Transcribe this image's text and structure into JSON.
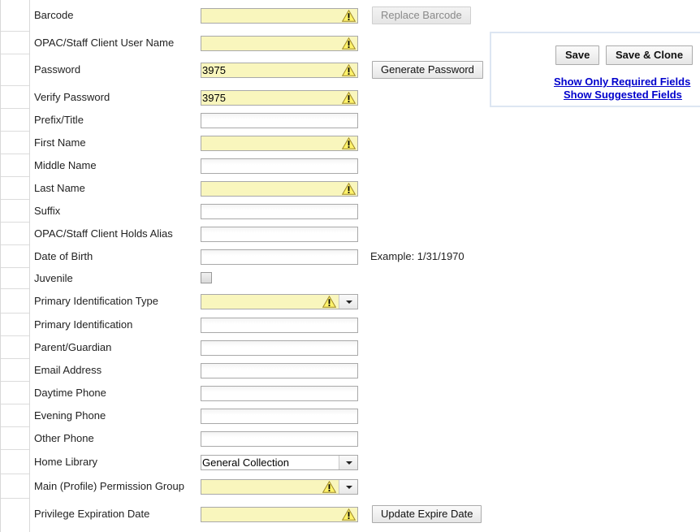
{
  "form": {
    "rows": [
      {
        "label": "Barcode",
        "value": "",
        "required": true
      },
      {
        "label": "OPAC/Staff Client User Name",
        "value": "",
        "required": true
      },
      {
        "label": "Password",
        "value": "3975",
        "required": true
      },
      {
        "label": "Verify Password",
        "value": "3975",
        "required": true
      },
      {
        "label": "Prefix/Title",
        "value": ""
      },
      {
        "label": "First Name",
        "value": "",
        "required": true
      },
      {
        "label": "Middle Name",
        "value": ""
      },
      {
        "label": "Last Name",
        "value": "",
        "required": true
      },
      {
        "label": "Suffix",
        "value": ""
      },
      {
        "label": "OPAC/Staff Client Holds Alias",
        "value": ""
      },
      {
        "label": "Date of Birth",
        "value": "",
        "hint": "Example: 1/31/1970"
      },
      {
        "label": "Juvenile",
        "checked": false
      },
      {
        "label": "Primary Identification Type",
        "value": "",
        "required": true
      },
      {
        "label": "Primary Identification",
        "value": ""
      },
      {
        "label": "Parent/Guardian",
        "value": ""
      },
      {
        "label": "Email Address",
        "value": ""
      },
      {
        "label": "Daytime Phone",
        "value": ""
      },
      {
        "label": "Evening Phone",
        "value": ""
      },
      {
        "label": "Other Phone",
        "value": ""
      },
      {
        "label": "Home Library",
        "value": "General Collection"
      },
      {
        "label": "Main (Profile) Permission Group",
        "value": "",
        "required": true
      },
      {
        "label": "Privilege Expiration Date",
        "value": "",
        "required": true
      }
    ],
    "buttons": {
      "replace_barcode": "Replace Barcode",
      "generate_password": "Generate Password",
      "update_expire_date": "Update Expire Date"
    }
  },
  "panel": {
    "save": "Save",
    "save_clone": "Save & Clone",
    "show_required": "Show Only Required Fields",
    "show_suggested": "Show Suggested Fields"
  },
  "colors": {
    "required_field_bg": "#f9f6bd",
    "link": "#0000cc",
    "panel_border": "#dde6f2"
  }
}
